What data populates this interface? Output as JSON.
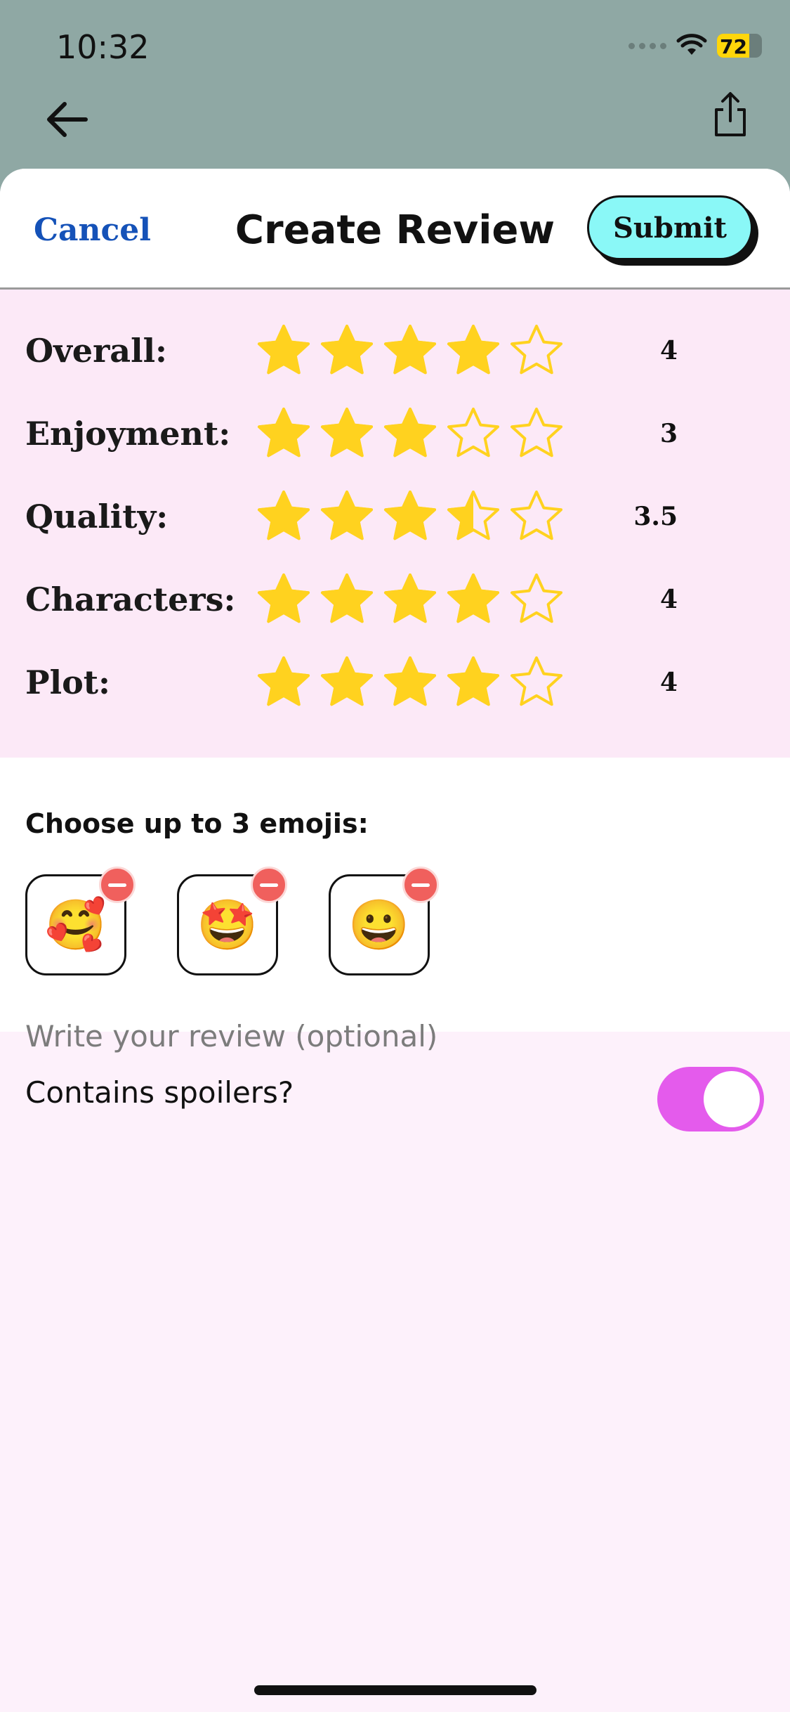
{
  "status_bar": {
    "time": "10:32",
    "battery": "72",
    "battery_level": 0.72
  },
  "header": {
    "cancel_label": "Cancel",
    "title": "Create Review",
    "submit_label": "Submit"
  },
  "ratings": [
    {
      "label": "Overall:",
      "value": "4",
      "stars": 4
    },
    {
      "label": "Enjoyment:",
      "value": "3",
      "stars": 3
    },
    {
      "label": "Quality:",
      "value": "3.5",
      "stars": 3.5
    },
    {
      "label": "Characters:",
      "value": "4",
      "stars": 4
    },
    {
      "label": "Plot:",
      "value": "4",
      "stars": 4
    }
  ],
  "emojis": {
    "title": "Choose up to 3 emojis:",
    "items": [
      "🥰",
      "🤩",
      "😀"
    ]
  },
  "spoilers": {
    "label": "Contains spoilers?",
    "enabled": true
  },
  "review": {
    "placeholder": "Write your review (optional)",
    "value": ""
  },
  "colors": {
    "star": "#ffd21f",
    "submit_bg": "#8af8f7",
    "toggle_on": "#e45bec",
    "cancel": "#1552b8"
  }
}
